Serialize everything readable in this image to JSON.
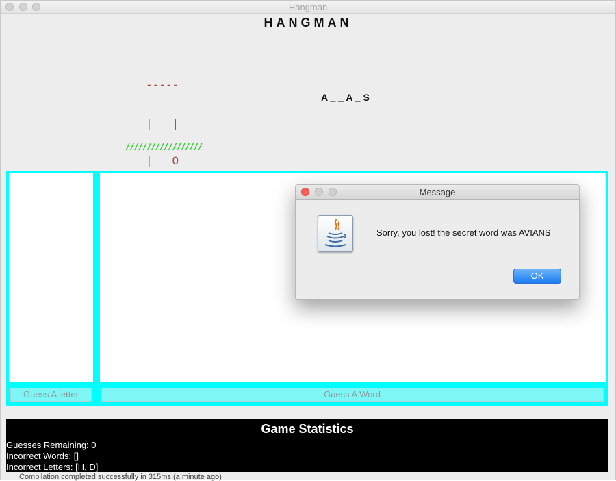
{
  "window": {
    "title": "Hangman"
  },
  "app": {
    "title": "HANGMAN"
  },
  "gallows": {
    "lines": [
      "-----",
      "|   |",
      "|   O",
      "|  --",
      "|   |",
      "|  /\\"
    ]
  },
  "progress_slashes": "//////////////////",
  "masked_word": "A _ _ A _ S",
  "buttons": {
    "guess_letter": "Guess A letter",
    "guess_word": "Guess A Word"
  },
  "stats": {
    "title": "Game Statistics",
    "guesses_remaining": "Guesses Remaining: 0",
    "incorrect_words": "Incorrect Words: []",
    "incorrect_letters": "Incorrect Letters: [H, D]"
  },
  "dialog": {
    "title": "Message",
    "message": "Sorry, you lost! the secret word was AVIANS",
    "ok_label": "OK",
    "icon": "java-coffee-cup-icon"
  },
  "background_fragment": "Compilation completed successfully in 315ms (a minute ago)",
  "colors": {
    "panel_accent": "#00ffff",
    "gallows": "#a0503c",
    "slashes": "#22d322",
    "stats_background": "#000000",
    "ok_button": "#1c7cf2"
  }
}
